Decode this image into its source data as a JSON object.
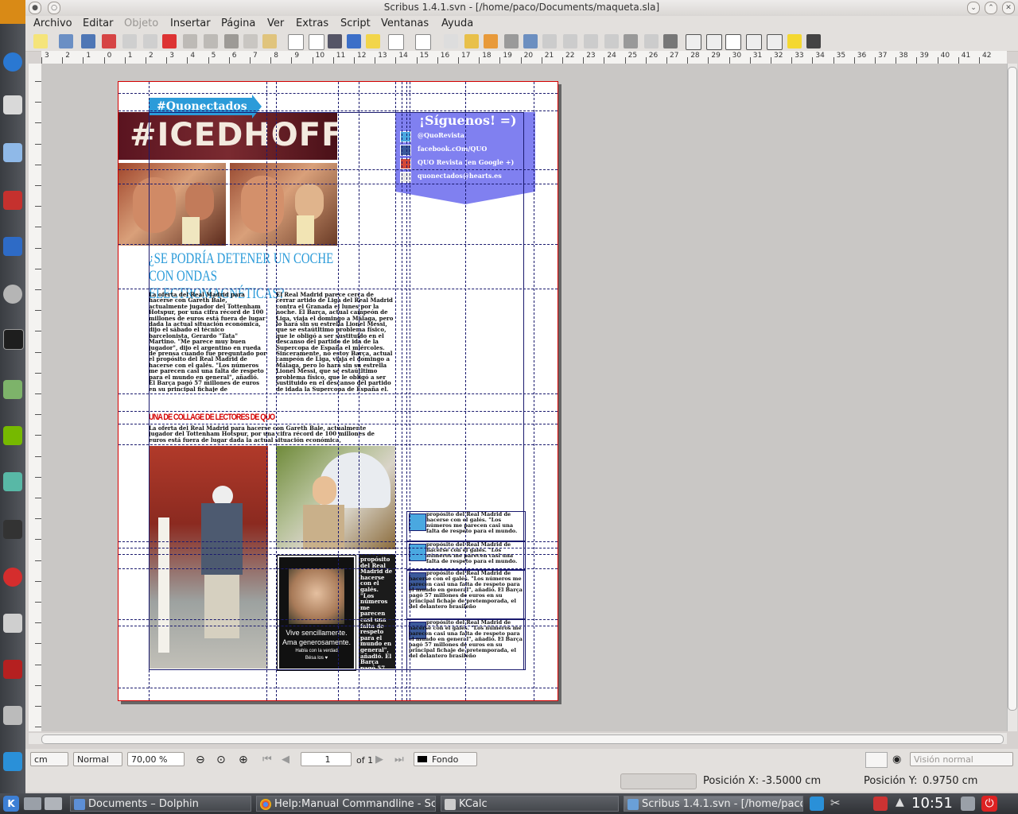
{
  "window": {
    "title": "Scribus 1.4.1.svn - [/home/paco/Documents/maqueta.sla]"
  },
  "menu": [
    {
      "label": "Archivo",
      "disabled": false
    },
    {
      "label": "Editar",
      "disabled": false
    },
    {
      "label": "Objeto",
      "disabled": true
    },
    {
      "label": "Insertar",
      "disabled": false
    },
    {
      "label": "Página",
      "disabled": false
    },
    {
      "label": "Ver",
      "disabled": false
    },
    {
      "label": "Extras",
      "disabled": false
    },
    {
      "label": "Script",
      "disabled": false
    },
    {
      "label": "Ventanas",
      "disabled": false
    },
    {
      "label": "Ayuda",
      "disabled": false
    }
  ],
  "ruler": {
    "top_labels": [
      "3",
      "2",
      "1",
      "0",
      "1",
      "2",
      "3",
      "4",
      "5",
      "6",
      "7",
      "8",
      "9",
      "10",
      "11",
      "12",
      "13",
      "14",
      "15",
      "16",
      "17",
      "18",
      "19",
      "20",
      "21",
      "22",
      "23",
      "24",
      "25",
      "26",
      "27",
      "28",
      "29",
      "30",
      "31",
      "32",
      "33",
      "34",
      "35",
      "36",
      "37",
      "38",
      "39",
      "40",
      "41",
      "42"
    ]
  },
  "document": {
    "badge": "#Quonectados",
    "banner_headline": "#ICEDHOFFEE",
    "follow_title": "¡Síguenos! =)",
    "follow_items": [
      {
        "icon": "twitter-icon",
        "label": "@QuoRevista",
        "color": "#4aa8e0"
      },
      {
        "icon": "facebook-icon",
        "label": "facebook.cOm/QUO",
        "color": "#3b5a9a"
      },
      {
        "icon": "google-plus-icon",
        "label": "QUO Revista (en Google +)",
        "color": "#d34836"
      },
      {
        "icon": "gmail-icon",
        "label": "quonectados@hearts.es",
        "color": "#e8e8e8"
      }
    ],
    "headline1": "¿SE PODRÍA DETENER UN COCHE CON ONDAS ELECTROMAGNÉTICAS?",
    "col1": "La oferta del Real Madrid para hacerse con Gareth Bale, actualmente jugador del Tottenham Hotspur, por una cifra récord de 100 millones de euros está fuera de lugar dada la actual situación económica, dijo el sábado el técnico barcelonista, Gerardo \"Tata\" Martino. \"Me parece muy buen jugador\", dijo el argentino en rueda de prensa cuando fue preguntado por el propósito del Real Madrid de hacerse con el galés. \"Los números me parecen casi una falta de respeto para el mundo en general\", añadió. El Barça pagó 57 millones de euros en su principal fichaje de pretemporada, el del delantero brasileño Neymar.",
    "col2": "El Real Madrid parece cerca de cerrar artido de Liga del Real Madrid contra el Granada el lunes por la noche. El Barça, actual campeón de Liga, viaja el domingo a Málaga, pero lo hará sin su estrella Lionel Messi, que se estaútltimo problema físico, que le obligó a ser sustituido en el descanso del partido de ida de la Supercopa de España el miércoles. Sinceramente, no estoy Barça, actual campeón de Liga, viaja el domingo a Málaga, pero lo hará sin su estrella Lionel Messi, que se estaútltimo problema físico, que le obligó a ser sustituido en el descanso del partido de idada la Supercopa de España el.",
    "headline2": "UNA DE COLLAGE DE LECTORES DE QUO",
    "intro2": "La oferta del Real Madrid para hacerse con Gareth Bale, actualmente jugador del Tottenham Hotspur, por una cifra récord de 100 millones de euros está fuera de lugar dada la actual situación económica,",
    "poster_line1": "Vive sencillamente.",
    "poster_line2": "Ama generosamente.",
    "poster_line3": "Habla con la verdad",
    "poster_line4": "Bésa los ♥",
    "sidebar_text": "propósito del Real Madrid de hacerse con el galés. \"Los números me parecen casi una falta de respeto para el mundo en general\", añadió. El Barça pagó 57 millones de euros",
    "social_posts": [
      {
        "icon": "twitter-icon",
        "text": "propósito del Real Madrid de hacerse con el galés. \"Los números me parecen casi una falta de respeto para el mundo."
      },
      {
        "icon": "twitter-icon",
        "text": "propósito del Real Madrid de hacerse con el galés. \"Los números me parecen casi una falta de respeto para el mundo."
      },
      {
        "icon": "facebook-icon",
        "text": "propósito del Real Madrid de hacerse con el galés. \"Los números me parecen casi una falta de respeto para el mundo en general\", añadió. El Barça pagó 57 millones de euros en su principal fichaje de pretemporada, el del delantero brasileño"
      },
      {
        "icon": "facebook-icon",
        "text": "propósito del Real Madrid de hacerse con el galés. \"Los números me parecen casi una falta de respeto para el mundo en general\", añadió. El Barça pagó 57 millones de euros en su principal fichaje de pretemporada, el del delantero brasileño"
      }
    ]
  },
  "statusbar": {
    "unit": "cm",
    "mode": "Normal",
    "zoom": "70,00 %",
    "page_current": "1",
    "page_of": "of 1",
    "layer": "Fondo",
    "view": "Visión normal"
  },
  "coords": {
    "x_label": "Posición X:",
    "x_value": "-3.5000 cm",
    "y_label": "Posición Y:",
    "y_value": "0.9750 cm"
  },
  "taskbar": {
    "tasks": [
      {
        "label": "Documents – Dolphin",
        "active": false
      },
      {
        "label": "Help:Manual Commandline - Scr",
        "active": false
      },
      {
        "label": "KCalc",
        "active": false
      },
      {
        "label": "Scribus 1.4.1.svn - [/home/paco",
        "active": true
      }
    ],
    "clock": "10:51"
  }
}
